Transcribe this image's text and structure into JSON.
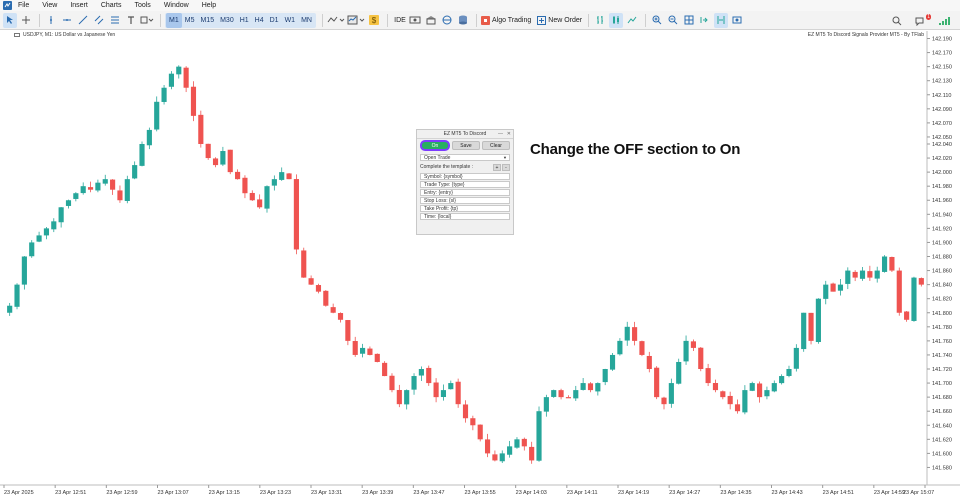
{
  "menu": [
    "File",
    "View",
    "Insert",
    "Charts",
    "Tools",
    "Window",
    "Help"
  ],
  "toolbar": {
    "timeframes": [
      "M1",
      "M5",
      "M15",
      "M30",
      "H1",
      "H4",
      "D1",
      "W1",
      "MN"
    ],
    "active_timeframe": "M1",
    "ide_label": "IDE",
    "algo_trading_label": "Algo Trading",
    "new_order_label": "New Order",
    "notification_count": "1"
  },
  "chart": {
    "title": "USDJPY, M1:  US Dollar vs Japanese Yen",
    "ea_label": "EZ MT5 To Discord Signals Provider MT5 - By TFlab",
    "annotation": "Change the OFF section to On"
  },
  "panel": {
    "title": "EZ MT5 To Discord",
    "on_label": "On",
    "save_label": "Save",
    "clear_label": "Clear",
    "mode_value": "Open Trade",
    "template_label": "Complete the template :",
    "plus": "+",
    "minus": "-",
    "fields": [
      "Symbol: {symbol}",
      "Trade Type: {type}",
      "Entry: {entry}",
      "Stop Loss: {sl}",
      "Take Profit: {tp}",
      "Time: {local}"
    ]
  },
  "colors": {
    "bull": "#26a69a",
    "bear": "#ef5350",
    "accent_on": "#27ae60",
    "highlight_border": "#7d3cff"
  },
  "chart_data": {
    "type": "candlestick",
    "symbol": "USDJPY",
    "timeframe": "M1",
    "y_ticks": [
      142.19,
      142.17,
      142.15,
      142.13,
      142.11,
      142.09,
      142.07,
      142.05,
      142.04,
      142.02,
      142.0,
      141.98,
      141.96,
      141.94,
      141.92,
      141.9,
      141.88,
      141.86,
      141.84,
      141.82,
      141.8,
      141.78,
      141.76,
      141.74,
      141.72,
      141.7,
      141.68,
      141.66,
      141.64,
      141.62,
      141.6,
      141.58
    ],
    "y_tick_labels": [
      "142.190",
      "142.170",
      "142.150",
      "142.130",
      "142.110",
      "142.090",
      "142.070",
      "142.050",
      "142.040",
      "142.020",
      "142.000",
      "141.980",
      "141.960",
      "141.940",
      "141.920",
      "141.900",
      "141.880",
      "141.860",
      "141.840",
      "141.820",
      "141.800",
      "141.780",
      "141.760",
      "141.740",
      "141.720",
      "141.700",
      "141.680",
      "141.660",
      "141.640",
      "141.620",
      "141.600",
      "141.580"
    ],
    "x_labels": [
      "23 Apr 2025",
      "23 Apr 12:51",
      "23 Apr 12:59",
      "23 Apr 13:07",
      "23 Apr 13:15",
      "23 Apr 13:23",
      "23 Apr 13:31",
      "23 Apr 13:39",
      "23 Apr 13:47",
      "23 Apr 13:55",
      "23 Apr 14:03",
      "23 Apr 14:11",
      "23 Apr 14:19",
      "23 Apr 14:27",
      "23 Apr 14:35",
      "23 Apr 14:43",
      "23 Apr 14:51",
      "23 Apr 14:59",
      "23 Apr 15:07"
    ],
    "ylim": [
      141.565,
      142.195
    ],
    "close_path": [
      141.81,
      141.84,
      141.88,
      141.9,
      141.91,
      141.92,
      141.93,
      141.95,
      141.96,
      141.97,
      141.98,
      141.975,
      141.985,
      141.99,
      141.975,
      141.96,
      141.99,
      142.01,
      142.04,
      142.06,
      142.1,
      142.12,
      142.14,
      142.15,
      142.12,
      142.08,
      142.04,
      142.02,
      142.01,
      142.03,
      142.0,
      141.99,
      141.97,
      141.96,
      141.95,
      141.98,
      141.99,
      142.0,
      141.99,
      141.89,
      141.85,
      141.84,
      141.83,
      141.81,
      141.8,
      141.79,
      141.76,
      141.74,
      141.75,
      141.74,
      141.73,
      141.71,
      141.69,
      141.67,
      141.69,
      141.71,
      141.72,
      141.7,
      141.68,
      141.69,
      141.7,
      141.67,
      141.65,
      141.64,
      141.62,
      141.6,
      141.59,
      141.6,
      141.61,
      141.62,
      141.61,
      141.59,
      141.66,
      141.68,
      141.69,
      141.68,
      141.68,
      141.69,
      141.7,
      141.69,
      141.7,
      141.72,
      141.74,
      141.76,
      141.78,
      141.76,
      141.74,
      141.72,
      141.68,
      141.67,
      141.7,
      141.73,
      141.76,
      141.75,
      141.72,
      141.7,
      141.69,
      141.68,
      141.67,
      141.66,
      141.69,
      141.7,
      141.68,
      141.69,
      141.7,
      141.71,
      141.72,
      141.75,
      141.8,
      141.76,
      141.82,
      141.84,
      141.83,
      141.84,
      141.86,
      141.85,
      141.86,
      141.85,
      141.86,
      141.88,
      141.86,
      141.8,
      141.79,
      141.85,
      141.84
    ]
  }
}
